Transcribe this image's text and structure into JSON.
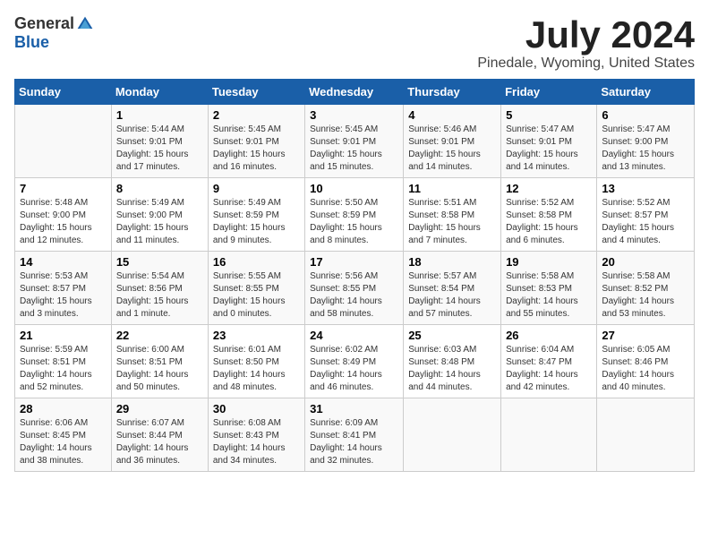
{
  "logo": {
    "general": "General",
    "blue": "Blue"
  },
  "title": "July 2024",
  "location": "Pinedale, Wyoming, United States",
  "headers": [
    "Sunday",
    "Monday",
    "Tuesday",
    "Wednesday",
    "Thursday",
    "Friday",
    "Saturday"
  ],
  "weeks": [
    [
      {
        "num": "",
        "info": ""
      },
      {
        "num": "1",
        "info": "Sunrise: 5:44 AM\nSunset: 9:01 PM\nDaylight: 15 hours\nand 17 minutes."
      },
      {
        "num": "2",
        "info": "Sunrise: 5:45 AM\nSunset: 9:01 PM\nDaylight: 15 hours\nand 16 minutes."
      },
      {
        "num": "3",
        "info": "Sunrise: 5:45 AM\nSunset: 9:01 PM\nDaylight: 15 hours\nand 15 minutes."
      },
      {
        "num": "4",
        "info": "Sunrise: 5:46 AM\nSunset: 9:01 PM\nDaylight: 15 hours\nand 14 minutes."
      },
      {
        "num": "5",
        "info": "Sunrise: 5:47 AM\nSunset: 9:01 PM\nDaylight: 15 hours\nand 14 minutes."
      },
      {
        "num": "6",
        "info": "Sunrise: 5:47 AM\nSunset: 9:00 PM\nDaylight: 15 hours\nand 13 minutes."
      }
    ],
    [
      {
        "num": "7",
        "info": "Sunrise: 5:48 AM\nSunset: 9:00 PM\nDaylight: 15 hours\nand 12 minutes."
      },
      {
        "num": "8",
        "info": "Sunrise: 5:49 AM\nSunset: 9:00 PM\nDaylight: 15 hours\nand 11 minutes."
      },
      {
        "num": "9",
        "info": "Sunrise: 5:49 AM\nSunset: 8:59 PM\nDaylight: 15 hours\nand 9 minutes."
      },
      {
        "num": "10",
        "info": "Sunrise: 5:50 AM\nSunset: 8:59 PM\nDaylight: 15 hours\nand 8 minutes."
      },
      {
        "num": "11",
        "info": "Sunrise: 5:51 AM\nSunset: 8:58 PM\nDaylight: 15 hours\nand 7 minutes."
      },
      {
        "num": "12",
        "info": "Sunrise: 5:52 AM\nSunset: 8:58 PM\nDaylight: 15 hours\nand 6 minutes."
      },
      {
        "num": "13",
        "info": "Sunrise: 5:52 AM\nSunset: 8:57 PM\nDaylight: 15 hours\nand 4 minutes."
      }
    ],
    [
      {
        "num": "14",
        "info": "Sunrise: 5:53 AM\nSunset: 8:57 PM\nDaylight: 15 hours\nand 3 minutes."
      },
      {
        "num": "15",
        "info": "Sunrise: 5:54 AM\nSunset: 8:56 PM\nDaylight: 15 hours\nand 1 minute."
      },
      {
        "num": "16",
        "info": "Sunrise: 5:55 AM\nSunset: 8:55 PM\nDaylight: 15 hours\nand 0 minutes."
      },
      {
        "num": "17",
        "info": "Sunrise: 5:56 AM\nSunset: 8:55 PM\nDaylight: 14 hours\nand 58 minutes."
      },
      {
        "num": "18",
        "info": "Sunrise: 5:57 AM\nSunset: 8:54 PM\nDaylight: 14 hours\nand 57 minutes."
      },
      {
        "num": "19",
        "info": "Sunrise: 5:58 AM\nSunset: 8:53 PM\nDaylight: 14 hours\nand 55 minutes."
      },
      {
        "num": "20",
        "info": "Sunrise: 5:58 AM\nSunset: 8:52 PM\nDaylight: 14 hours\nand 53 minutes."
      }
    ],
    [
      {
        "num": "21",
        "info": "Sunrise: 5:59 AM\nSunset: 8:51 PM\nDaylight: 14 hours\nand 52 minutes."
      },
      {
        "num": "22",
        "info": "Sunrise: 6:00 AM\nSunset: 8:51 PM\nDaylight: 14 hours\nand 50 minutes."
      },
      {
        "num": "23",
        "info": "Sunrise: 6:01 AM\nSunset: 8:50 PM\nDaylight: 14 hours\nand 48 minutes."
      },
      {
        "num": "24",
        "info": "Sunrise: 6:02 AM\nSunset: 8:49 PM\nDaylight: 14 hours\nand 46 minutes."
      },
      {
        "num": "25",
        "info": "Sunrise: 6:03 AM\nSunset: 8:48 PM\nDaylight: 14 hours\nand 44 minutes."
      },
      {
        "num": "26",
        "info": "Sunrise: 6:04 AM\nSunset: 8:47 PM\nDaylight: 14 hours\nand 42 minutes."
      },
      {
        "num": "27",
        "info": "Sunrise: 6:05 AM\nSunset: 8:46 PM\nDaylight: 14 hours\nand 40 minutes."
      }
    ],
    [
      {
        "num": "28",
        "info": "Sunrise: 6:06 AM\nSunset: 8:45 PM\nDaylight: 14 hours\nand 38 minutes."
      },
      {
        "num": "29",
        "info": "Sunrise: 6:07 AM\nSunset: 8:44 PM\nDaylight: 14 hours\nand 36 minutes."
      },
      {
        "num": "30",
        "info": "Sunrise: 6:08 AM\nSunset: 8:43 PM\nDaylight: 14 hours\nand 34 minutes."
      },
      {
        "num": "31",
        "info": "Sunrise: 6:09 AM\nSunset: 8:41 PM\nDaylight: 14 hours\nand 32 minutes."
      },
      {
        "num": "",
        "info": ""
      },
      {
        "num": "",
        "info": ""
      },
      {
        "num": "",
        "info": ""
      }
    ]
  ]
}
